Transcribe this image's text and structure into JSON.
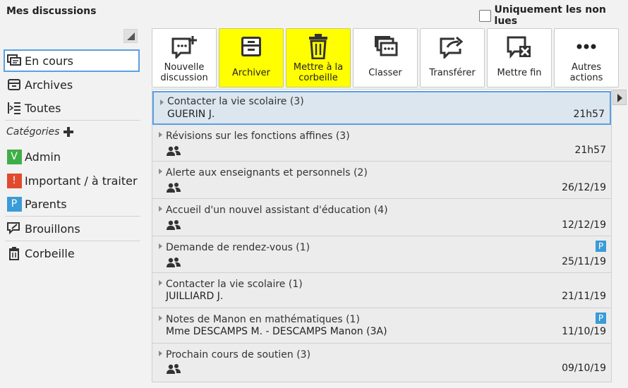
{
  "header": {
    "title": "Mes discussions",
    "unread_only_label": "Uniquement les non lues",
    "unread_only_checked": false
  },
  "sidebar": {
    "folders": [
      {
        "label": "En cours",
        "icon": "conversation-icon",
        "active": true
      },
      {
        "label": "Archives",
        "icon": "archive-box-icon",
        "active": false
      },
      {
        "label": "Toutes",
        "icon": "list-indent-icon",
        "active": false
      }
    ],
    "categories_label": "Catégories",
    "categories": [
      {
        "badge": "V",
        "label": "Admin",
        "color": "#3fae48"
      },
      {
        "badge": "!",
        "label": "Important / à traiter",
        "color": "#e04a2f"
      },
      {
        "badge": "P",
        "label": "Parents",
        "color": "#3b9bd7"
      }
    ],
    "bottom": [
      {
        "label": "Brouillons",
        "icon": "draft-pen-icon"
      },
      {
        "label": "Corbeille",
        "icon": "trash-icon"
      }
    ]
  },
  "toolbar": {
    "buttons": [
      {
        "label": "Nouvelle\ndiscussion",
        "icon": "new-discussion-icon",
        "highlighted": false
      },
      {
        "label": "Archiver",
        "icon": "archive-box-icon",
        "highlighted": true
      },
      {
        "label": "Mettre à la\ncorbeille",
        "icon": "trash-icon",
        "highlighted": true
      },
      {
        "label": "Classer",
        "icon": "classify-icon",
        "highlighted": false
      },
      {
        "label": "Transférer",
        "icon": "forward-icon",
        "highlighted": false
      },
      {
        "label": "Mettre fin",
        "icon": "end-discussion-icon",
        "highlighted": false
      },
      {
        "label": "Autres\nactions",
        "icon": "more-dots-icon",
        "highlighted": false
      }
    ]
  },
  "discussions": [
    {
      "title": "Contacter la vie scolaire (3)",
      "participant": "GUERIN J.",
      "group": false,
      "date": "21h57",
      "tag": "",
      "selected": true
    },
    {
      "title": "Révisions sur les fonctions affines (3)",
      "participant": "",
      "group": true,
      "date": "21h57",
      "tag": "",
      "selected": false
    },
    {
      "title": "Alerte aux enseignants et personnels (2)",
      "participant": "",
      "group": true,
      "date": "26/12/19",
      "tag": "",
      "selected": false
    },
    {
      "title": "Accueil d'un nouvel assistant d'éducation (4)",
      "participant": "",
      "group": true,
      "date": "12/12/19",
      "tag": "",
      "selected": false
    },
    {
      "title": "Demande de rendez-vous (1)",
      "participant": "",
      "group": true,
      "date": "25/11/19",
      "tag": "P",
      "selected": false
    },
    {
      "title": "Contacter la vie scolaire (1)",
      "participant": "JUILLIARD J.",
      "group": false,
      "date": "21/11/19",
      "tag": "",
      "selected": false
    },
    {
      "title": "Notes de Manon en mathématiques (1)",
      "participant": "Mme DESCAMPS M. - DESCAMPS Manon (3A)",
      "group": false,
      "date": "11/10/19",
      "tag": "P",
      "selected": false
    },
    {
      "title": "Prochain cours de soutien (3)",
      "participant": "",
      "group": true,
      "date": "09/10/19",
      "tag": "",
      "selected": false
    }
  ]
}
